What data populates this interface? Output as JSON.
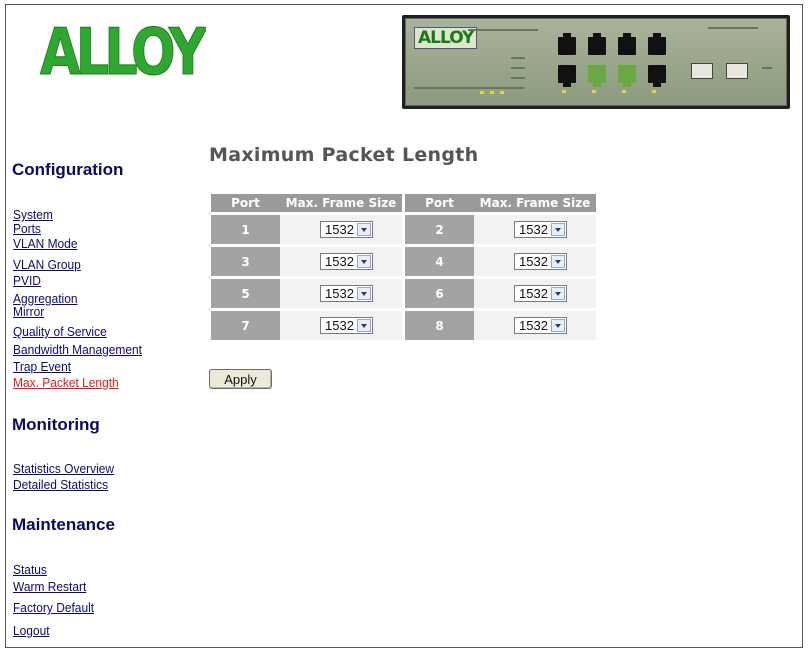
{
  "brand": {
    "logo_text": "ALLOY",
    "device_logo_text": "ALLOY",
    "accent_color": "#2fa832"
  },
  "sidebar": {
    "sections": [
      {
        "heading": "Configuration",
        "items": [
          "System",
          "Ports",
          "VLAN Mode",
          "VLAN Group",
          "PVID",
          "Aggregation",
          "Mirror",
          "Quality of Service",
          "Bandwidth Management",
          "Trap Event",
          "Max. Packet Length"
        ]
      },
      {
        "heading": "Monitoring",
        "items": [
          "Statistics Overview",
          "Detailed Statistics"
        ]
      },
      {
        "heading": "Maintenance",
        "items": [
          "Status",
          "Warm Restart",
          "Factory Default",
          "Logout"
        ]
      }
    ],
    "active_item": "Max. Packet Length"
  },
  "main": {
    "title": "Maximum Packet Length",
    "table": {
      "headers": [
        "Port",
        "Max. Frame Size",
        "Port",
        "Max. Frame Size"
      ],
      "rows": [
        [
          {
            "port": "1",
            "size": "1532"
          },
          {
            "port": "2",
            "size": "1532"
          }
        ],
        [
          {
            "port": "3",
            "size": "1532"
          },
          {
            "port": "4",
            "size": "1532"
          }
        ],
        [
          {
            "port": "5",
            "size": "1532"
          },
          {
            "port": "6",
            "size": "1532"
          }
        ],
        [
          {
            "port": "7",
            "size": "1532"
          },
          {
            "port": "8",
            "size": "1532"
          }
        ]
      ]
    },
    "apply_label": "Apply"
  }
}
